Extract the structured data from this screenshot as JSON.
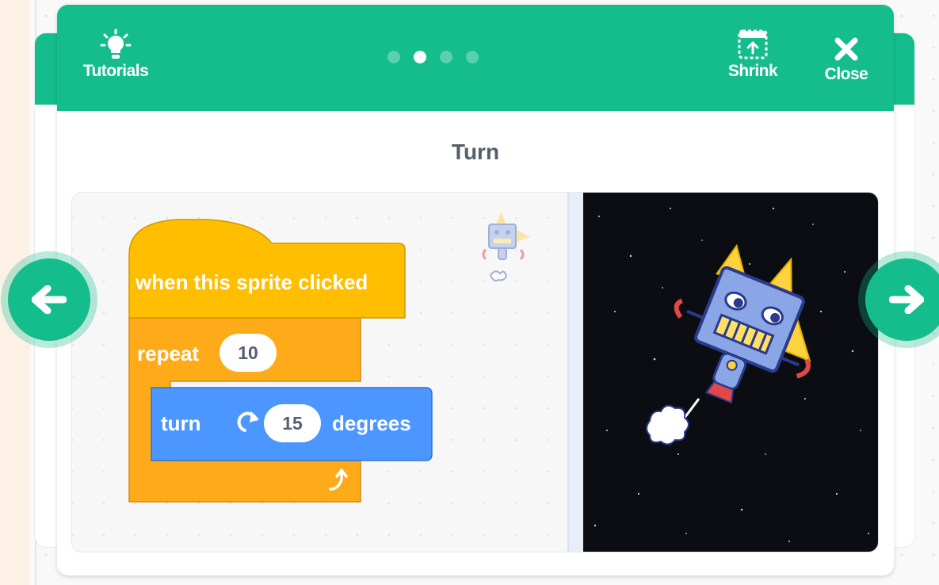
{
  "header": {
    "tutorials_label": "Tutorials",
    "shrink_label": "Shrink",
    "close_label": "Close",
    "steps": [
      {
        "active": false
      },
      {
        "active": true
      },
      {
        "active": false
      },
      {
        "active": false
      }
    ]
  },
  "step": {
    "title": "Turn"
  },
  "code": {
    "hat_label": "when this sprite clicked",
    "repeat_label": "repeat",
    "repeat_count": "10",
    "turn_label": "turn",
    "turn_degrees": "15",
    "degrees_label": "degrees"
  },
  "colors": {
    "header": "#15bd8c",
    "events_block": "#ffbf00",
    "control_block": "#ffab19",
    "motion_block": "#4c97ff",
    "title_text": "#555e6b"
  },
  "icons": {
    "tutorials": "lightbulb-icon",
    "shrink": "shrink-icon",
    "close": "close-icon",
    "turn": "rotate-right-icon",
    "loop": "loop-arrow-icon",
    "previous": "arrow-left-icon",
    "next": "arrow-right-icon"
  }
}
